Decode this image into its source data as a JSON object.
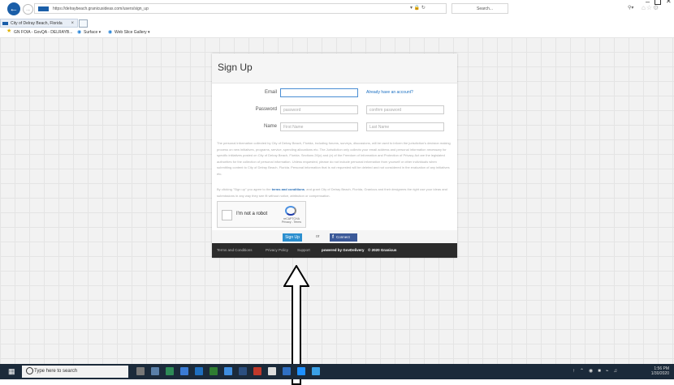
{
  "browser": {
    "url": "https://delraybeach.granicusideas.com/users/sign_up",
    "search_placeholder": "Search...",
    "tab_title": "City of Delray Beach, Florida",
    "favorites": [
      "GN FOIA - GovQA - DELRAYB...",
      "Surface ▾",
      "Web Slice Gallery ▾"
    ]
  },
  "page": {
    "title": "Sign Up",
    "email_label": "Email",
    "already_link": "Already have an account?",
    "password_label": "Password",
    "password_placeholder": "password",
    "confirm_placeholder": "confirm password",
    "name_label": "Name",
    "first_placeholder": "First Name",
    "last_placeholder": "Last Name",
    "privacy_text": "The personal information collected by City of Delray Beach, Florida, including forums, surveys, discussions, will be used to inform the jurisdiction's decision making process on new initiatives, programs, service, spending allocations etc. The Jurisdiction only collects your email address and personal information necessary for specific initiatives posted on City of Delray Beach, Florida. Sections 26(c) and (e) of the Freedom of Information and Protection of Privacy Act are the legislated authorities for the collection of personal information. Unless requested, please do not include personal information from yourself or other individuals when submitting content to City of Delray Beach, Florida. Personal information that is not requested will be deleted and not considered in the evaluation of any initiatives etc.",
    "terms_prefix": "By clicking \"Sign up\" you agree to the",
    "terms_link": "terms and conditions",
    "terms_suffix": ", and grant City of Delray Beach, Florida, Granicus and their designees the right use your ideas and submissions in any way they see fit without notice, attribution or compensation.",
    "captcha_label": "I'm not a robot",
    "captcha_brand": "reCAPTCHA",
    "captcha_links": "Privacy - Terms",
    "signup_button": "Sign Up",
    "or_text": "or",
    "facebook_button": "Connect",
    "footer": {
      "terms": "Terms and Conditions",
      "privacy": "Privacy Policy",
      "support": "Support",
      "powered": "powered by GovDelivery",
      "copyright": "© 2020 Granicus"
    }
  },
  "taskbar": {
    "search_placeholder": "Type here to search",
    "time": "1:56 PM",
    "date": "1/30/2020"
  }
}
